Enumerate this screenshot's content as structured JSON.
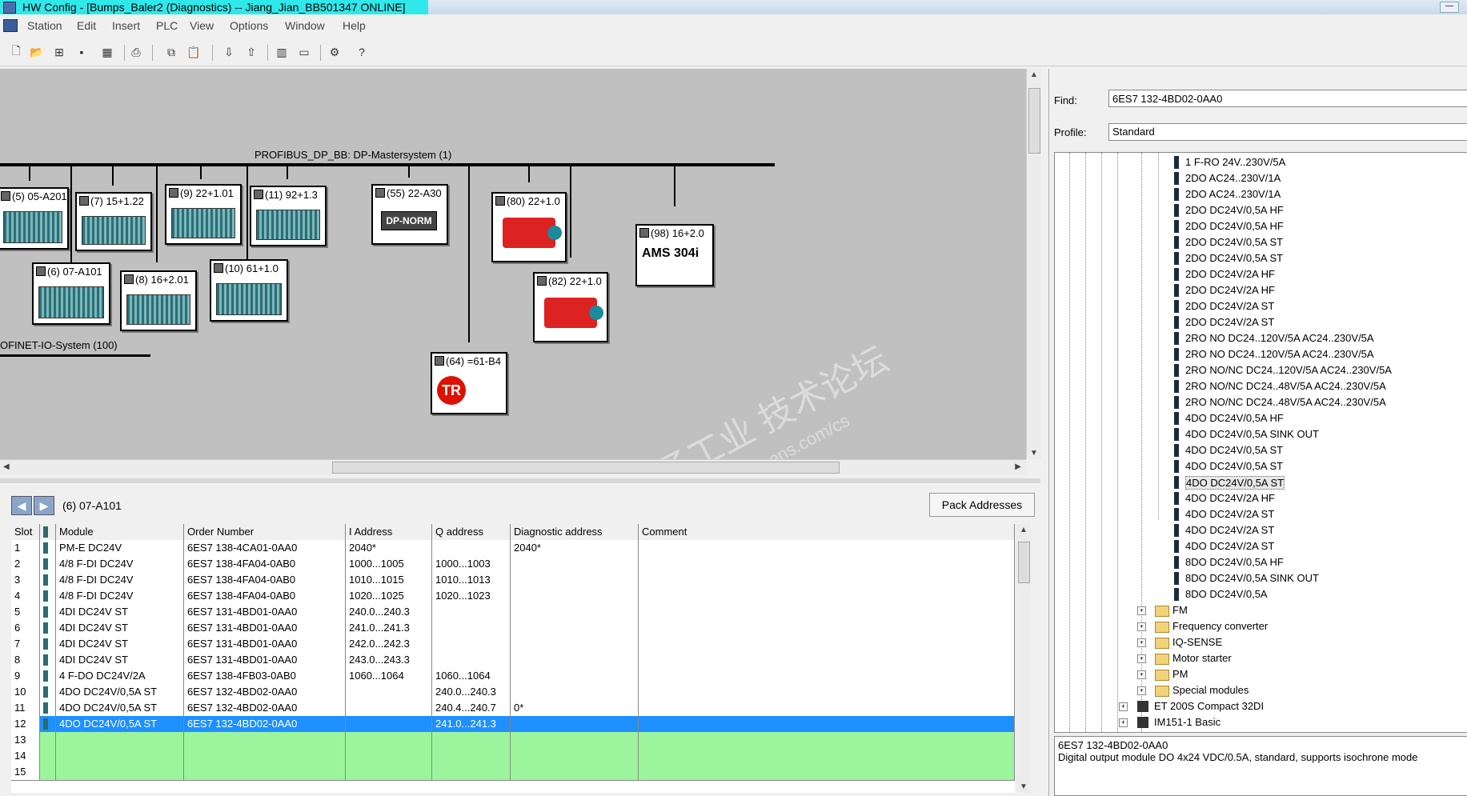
{
  "title": "HW Config - [Bumps_Baler2 (Diagnostics) -- Jiang_Jian_BB501347  ONLINE]",
  "menu": [
    "Station",
    "Edit",
    "Insert",
    "PLC",
    "View",
    "Options",
    "Window",
    "Help"
  ],
  "toolbar_icons": [
    "new-icon",
    "open-icon",
    "network-icon",
    "save-icon",
    "save-compile-icon",
    "print-icon",
    "copy-icon",
    "paste-icon",
    "download-icon",
    "upload-icon",
    "catalog-icon",
    "view-icon",
    "diagnostics-icon",
    "help-icon"
  ],
  "station": {
    "bus_label": "PROFIBUS_DP_BB: DP-Mastersystem (1)",
    "profinet_label": "OFINET-IO-System (100)",
    "slaves": [
      {
        "label": "(5) 05-A201",
        "kind": "rack"
      },
      {
        "label": "(7) 15+1.22",
        "kind": "rack"
      },
      {
        "label": "(9) 22+1.01",
        "kind": "rack"
      },
      {
        "label": "(11) 92+1.3",
        "kind": "rack"
      },
      {
        "label": "(55) 22-A30",
        "kind": "dpnorm",
        "text": "DP-NORM"
      },
      {
        "label": "(80) 22+1.0",
        "kind": "encoder"
      },
      {
        "label": "(98) 16+2.0",
        "kind": "ams",
        "text": "AMS 304i"
      },
      {
        "label": "(6) 07-A101",
        "kind": "rack"
      },
      {
        "label": "(8) 16+2.01",
        "kind": "rack"
      },
      {
        "label": "(10) 61+1.0",
        "kind": "rack"
      },
      {
        "label": "(82) 22+1.0",
        "kind": "encoder"
      },
      {
        "label": "(64) =61-B4",
        "kind": "tr",
        "text": "TR"
      }
    ],
    "watermark": "西门子工业 技术论坛",
    "watermark_url": "support.industry.siemens.com/cs"
  },
  "detail": {
    "title": "(6)   07-A101",
    "pack_button": "Pack Addresses",
    "columns": [
      "Slot",
      "",
      "Module",
      "Order Number",
      "I Address",
      "Q address",
      "Diagnostic address",
      "Comment"
    ],
    "rows": [
      {
        "slot": "1",
        "module": "PM-E DC24V",
        "order": "6ES7 138-4CA01-0AA0",
        "i": "2040*",
        "q": "",
        "diag": "2040*",
        "state": "normal"
      },
      {
        "slot": "2",
        "module": "4/8 F-DI DC24V",
        "order": "6ES7 138-4FA04-0AB0",
        "i": "1000...1005",
        "q": "1000...1003",
        "diag": "",
        "state": "normal"
      },
      {
        "slot": "3",
        "module": "4/8 F-DI DC24V",
        "order": "6ES7 138-4FA04-0AB0",
        "i": "1010...1015",
        "q": "1010...1013",
        "diag": "",
        "state": "normal"
      },
      {
        "slot": "4",
        "module": "4/8 F-DI DC24V",
        "order": "6ES7 138-4FA04-0AB0",
        "i": "1020...1025",
        "q": "1020...1023",
        "diag": "",
        "state": "normal"
      },
      {
        "slot": "5",
        "module": "4DI DC24V ST",
        "order": "6ES7 131-4BD01-0AA0",
        "i": "240.0...240.3",
        "q": "",
        "diag": "",
        "state": "normal"
      },
      {
        "slot": "6",
        "module": "4DI DC24V ST",
        "order": "6ES7 131-4BD01-0AA0",
        "i": "241.0...241.3",
        "q": "",
        "diag": "",
        "state": "normal"
      },
      {
        "slot": "7",
        "module": "4DI DC24V ST",
        "order": "6ES7 131-4BD01-0AA0",
        "i": "242.0...242.3",
        "q": "",
        "diag": "",
        "state": "normal"
      },
      {
        "slot": "8",
        "module": "4DI DC24V ST",
        "order": "6ES7 131-4BD01-0AA0",
        "i": "243.0...243.3",
        "q": "",
        "diag": "",
        "state": "normal"
      },
      {
        "slot": "9",
        "module": "4 F-DO DC24V/2A",
        "order": "6ES7 138-4FB03-0AB0",
        "i": "1060...1064",
        "q": "1060...1064",
        "diag": "",
        "state": "normal"
      },
      {
        "slot": "10",
        "module": "4DO DC24V/0,5A ST",
        "order": "6ES7 132-4BD02-0AA0",
        "i": "",
        "q": "240.0...240.3",
        "diag": "",
        "state": "normal"
      },
      {
        "slot": "11",
        "module": "4DO DC24V/0,5A ST",
        "order": "6ES7 132-4BD02-0AA0",
        "i": "",
        "q": "240.4...240.7",
        "diag": "0*",
        "state": "normal"
      },
      {
        "slot": "12",
        "module": "4DO DC24V/0,5A ST",
        "order": "6ES7 132-4BD02-0AA0",
        "i": "",
        "q": "241.0...241.3",
        "diag": "",
        "state": "selected"
      },
      {
        "slot": "13",
        "module": "",
        "order": "",
        "i": "",
        "q": "",
        "diag": "",
        "state": "empty"
      },
      {
        "slot": "14",
        "module": "",
        "order": "",
        "i": "",
        "q": "",
        "diag": "",
        "state": "empty"
      },
      {
        "slot": "15",
        "module": "",
        "order": "",
        "i": "",
        "q": "",
        "diag": "",
        "state": "empty"
      }
    ]
  },
  "catalog": {
    "find_label": "Find:",
    "find_value": "6ES7 132-4BD02-0AA0",
    "profile_label": "Profile:",
    "profile_value": "Standard",
    "leaves": [
      "1 F-RO 24V..230V/5A",
      "2DO AC24..230V/1A",
      "2DO AC24..230V/1A",
      "2DO DC24V/0,5A HF",
      "2DO DC24V/0,5A HF",
      "2DO DC24V/0,5A ST",
      "2DO DC24V/0,5A ST",
      "2DO DC24V/2A HF",
      "2DO DC24V/2A HF",
      "2DO DC24V/2A ST",
      "2DO DC24V/2A ST",
      "2RO NO DC24..120V/5A AC24..230V/5A",
      "2RO NO DC24..120V/5A AC24..230V/5A",
      "2RO NO/NC DC24..120V/5A AC24..230V/5A",
      "2RO NO/NC DC24..48V/5A AC24..230V/5A",
      "2RO NO/NC DC24..48V/5A AC24..230V/5A",
      "4DO DC24V/0,5A HF",
      "4DO DC24V/0,5A SINK OUT",
      "4DO DC24V/0,5A ST",
      "4DO DC24V/0,5A ST",
      "4DO DC24V/0,5A ST",
      "4DO DC24V/2A HF",
      "4DO DC24V/2A ST",
      "4DO DC24V/2A ST",
      "4DO DC24V/2A ST",
      "8DO DC24V/0,5A HF",
      "8DO DC24V/0,5A SINK OUT",
      "8DO DC24V/0,5A"
    ],
    "folders": [
      "FM",
      "Frequency converter",
      "IQ-SENSE",
      "Motor starter",
      "PM",
      "Special modules"
    ],
    "stations": [
      "ET 200S Compact 32DI",
      "IM151-1 Basic"
    ],
    "info_line1": "6ES7 132-4BD02-0AA0",
    "info_line2": "Digital output module DO 4x24 VDC/0.5A, standard, supports isochrone mode"
  }
}
